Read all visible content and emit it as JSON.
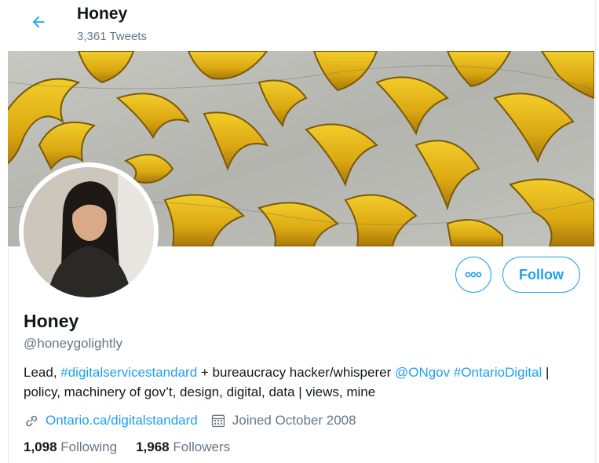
{
  "header": {
    "title": "Honey",
    "tweet_count": "3,361 Tweets",
    "back_icon": "arrow-left-icon"
  },
  "profile": {
    "name": "Honey",
    "handle": "@honeygolightly",
    "bio": {
      "t1": "Lead, ",
      "link1": "#digitalservicestandard",
      "t2": " + bureaucracy hacker/whisperer ",
      "link2": "@ONgov",
      "t3": " ",
      "link3": "#OntarioDigital",
      "t4": " | policy, machinery of gov’t, design, digital, data | views, mine"
    },
    "website": "Ontario.ca/digitalstandard",
    "joined": "Joined October 2008"
  },
  "actions": {
    "more_icon": "more-horizontal-icon",
    "follow_label": "Follow"
  },
  "stats": {
    "following_count": "1,098",
    "following_label": "Following",
    "followers_count": "1,968",
    "followers_label": "Followers"
  },
  "colors": {
    "accent": "#1da1f2",
    "secondary_text": "#657786",
    "primary_text": "#14171a",
    "banner_gold": "#e0b21a",
    "banner_marble": "#bcbcb6"
  }
}
